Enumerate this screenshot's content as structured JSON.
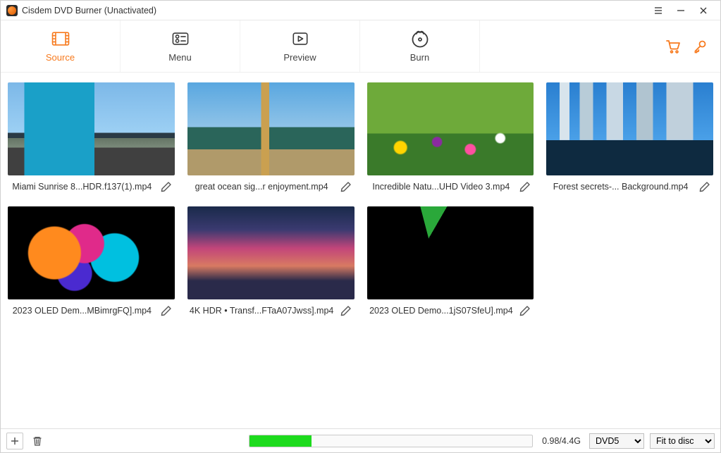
{
  "window": {
    "title": "Cisdem DVD Burner (Unactivated)"
  },
  "tabs": {
    "source": "Source",
    "menu": "Menu",
    "preview": "Preview",
    "burn": "Burn"
  },
  "clips": [
    {
      "filename": "Miami Sunrise 8...HDR.f137(1).mp4"
    },
    {
      "filename": "great ocean sig...r enjoyment.mp4"
    },
    {
      "filename": "Incredible Natu...UHD Video 3.mp4"
    },
    {
      "filename": "Forest secrets-... Background.mp4"
    },
    {
      "filename": "2023 OLED Dem...MBimrgFQ].mp4"
    },
    {
      "filename": "4K HDR • Transf...FTaA07Jwss].mp4"
    },
    {
      "filename": "2023 OLED Demo...1jS07SfeU].mp4"
    }
  ],
  "bottom": {
    "progress_percent": 22,
    "size_label": "0.98/4.4G",
    "disc_type": "DVD5",
    "fit_mode": "Fit to disc"
  }
}
